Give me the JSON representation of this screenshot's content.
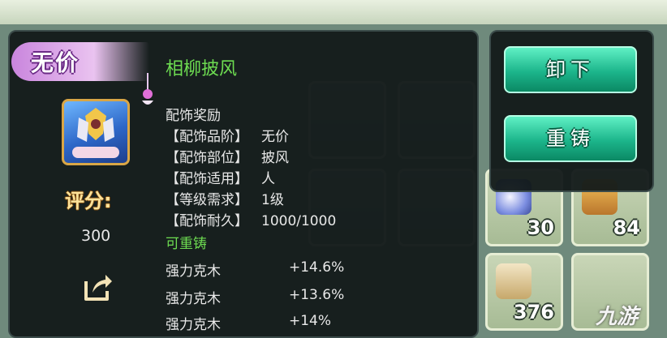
{
  "item": {
    "rank": "无价",
    "name": "相柳披风",
    "score_label": "评分:",
    "score_value": "300",
    "section_title": "配饰奖励",
    "attributes": [
      {
        "key": "【配饰品阶】",
        "value": "无价"
      },
      {
        "key": "【配饰部位】",
        "value": "披风"
      },
      {
        "key": "【配饰适用】",
        "value": "人"
      },
      {
        "key": "【等级需求】",
        "value": "1级"
      },
      {
        "key": "【配饰耐久】",
        "value": "1000/1000"
      }
    ],
    "recast_label": "可重铸",
    "bonuses": [
      {
        "name": "强力克木",
        "value": "+14.6%"
      },
      {
        "name": "强力克木",
        "value": "+13.6%"
      },
      {
        "name": "强力克木",
        "value": "+14%"
      }
    ]
  },
  "actions": {
    "unequip_label": "卸下",
    "recast_label": "重铸"
  },
  "inventory": {
    "counts": [
      "30",
      "84",
      "376"
    ]
  },
  "watermark": {
    "text": "九游"
  },
  "colors": {
    "rank_purple": "#c985dd",
    "name_green": "#6ddc51",
    "button_teal": "#1cb58b",
    "panel_bg": "#121919"
  }
}
